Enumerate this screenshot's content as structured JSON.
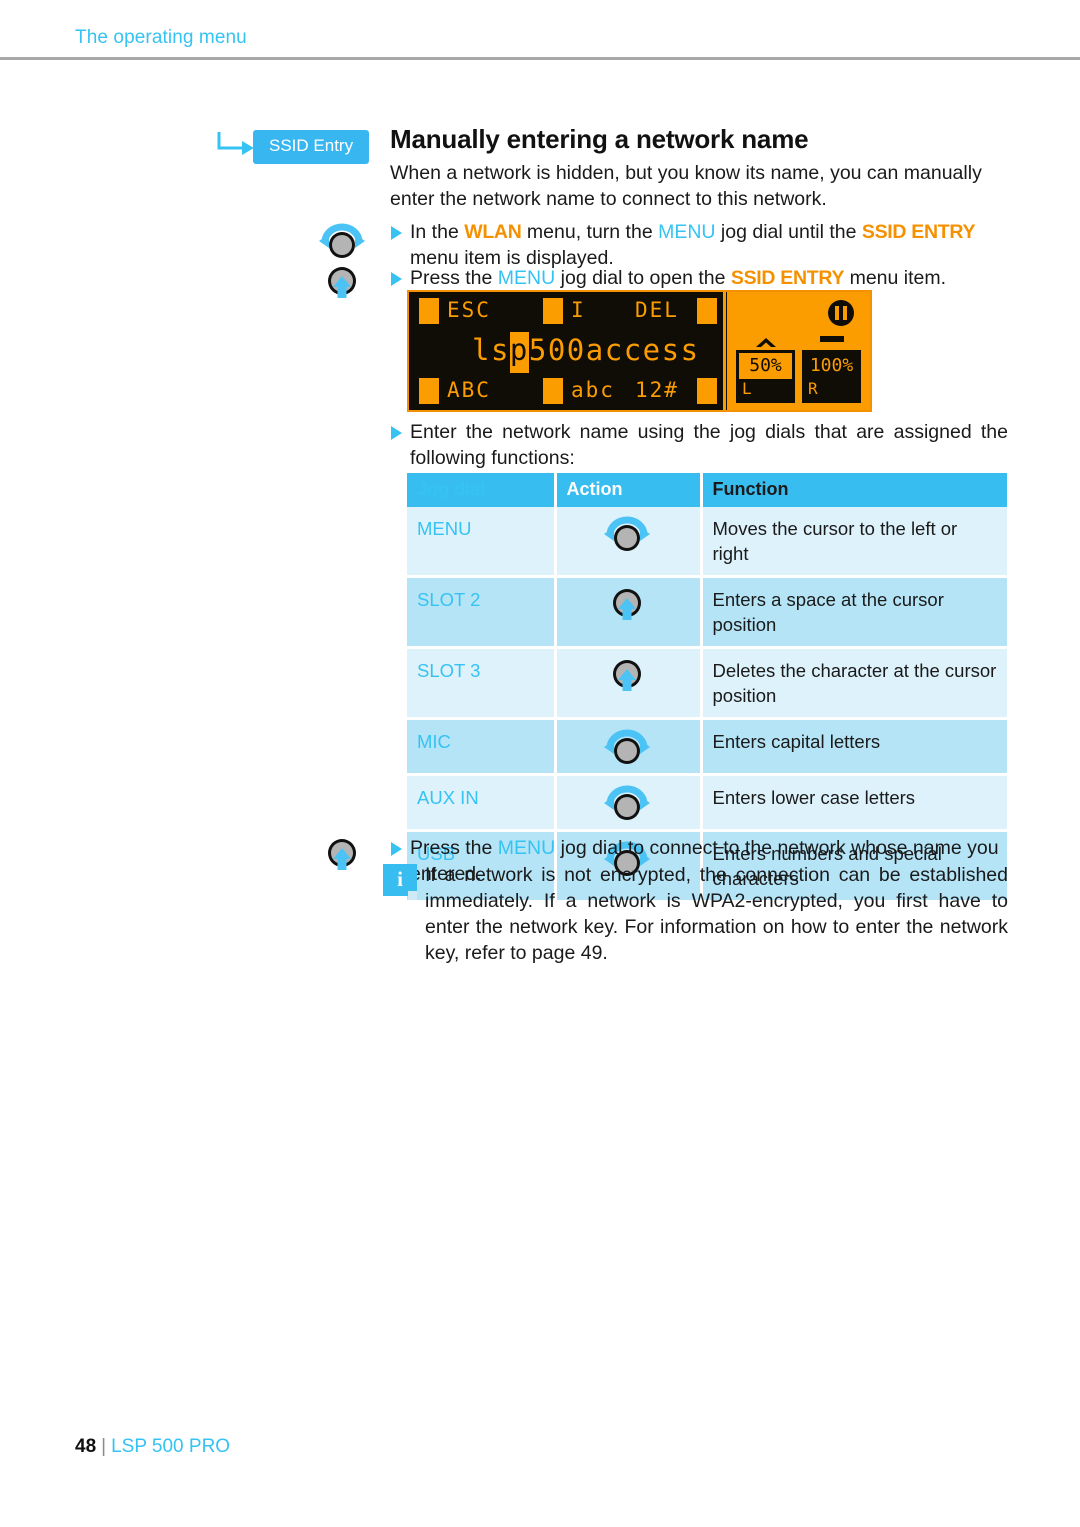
{
  "running_head": "The operating menu",
  "badge": {
    "label": "SSID Entry"
  },
  "heading": "Manually entering a network name",
  "intro": "When a network is hidden, but you know its name, you can manually enter the network name to connect to this network.",
  "steps": [
    {
      "id": "step-wlan",
      "icon": "jog-dial-rotate-icon",
      "parts": [
        {
          "t": "In the ",
          "s": "plain"
        },
        {
          "t": "WLAN",
          "s": "orange"
        },
        {
          "t": " menu, turn the ",
          "s": "plain"
        },
        {
          "t": "MENU",
          "s": "blue"
        },
        {
          "t": " jog dial until the ",
          "s": "plain"
        },
        {
          "t": "SSID ENTRY",
          "s": "orange"
        },
        {
          "t": " menu item is displayed.",
          "s": "plain"
        }
      ]
    },
    {
      "id": "step-press",
      "icon": "jog-dial-press-icon",
      "parts": [
        {
          "t": "Press the ",
          "s": "plain"
        },
        {
          "t": "MENU",
          "s": "blue"
        },
        {
          "t": " jog dial to open the ",
          "s": "plain"
        },
        {
          "t": "SSID ENTRY",
          "s": "orange"
        },
        {
          "t": " menu item.",
          "s": "plain"
        }
      ]
    }
  ],
  "lcd": {
    "top_labels": [
      "ESC",
      "I",
      "DEL"
    ],
    "bottom_labels": [
      "ABC",
      "abc",
      "12#"
    ],
    "ssid_before": "ls",
    "ssid_cursor": "p",
    "ssid_after": "500access",
    "left_meter": {
      "value": "50%",
      "channel": "L"
    },
    "right_meter": {
      "value": "100%",
      "channel": "R"
    },
    "status_icon": "pause-icon",
    "colors": {
      "amber": "#fb9c00",
      "background": "#100d07"
    }
  },
  "table_intro": "Enter the network name using the jog dials that are assigned the following functions:",
  "table": {
    "headers": [
      "Jog dial",
      "Action",
      "Function"
    ],
    "rows": [
      {
        "key": "MENU",
        "action_icon": "jog-dial-rotate-icon",
        "function": "Moves the cursor to the left or right"
      },
      {
        "key": "SLOT 2",
        "action_icon": "jog-dial-press-icon",
        "function": "Enters a space at the cursor position"
      },
      {
        "key": "SLOT 3",
        "action_icon": "jog-dial-press-icon",
        "function": "Deletes the character at the cursor position"
      },
      {
        "key": "MIC",
        "action_icon": "jog-dial-rotate-icon",
        "function": "Enters capital letters"
      },
      {
        "key": "AUX IN",
        "action_icon": "jog-dial-rotate-icon",
        "function": "Enters lower case letters"
      },
      {
        "key": "USB",
        "action_icon": "jog-dial-rotate-icon",
        "function": "Enters numbers and special characters"
      }
    ]
  },
  "final_step": {
    "icon": "jog-dial-press-icon",
    "parts": [
      {
        "t": "Press the ",
        "s": "plain"
      },
      {
        "t": "MENU",
        "s": "blue"
      },
      {
        "t": " jog dial to connect to the network whose name you entered.",
        "s": "plain"
      }
    ]
  },
  "note": {
    "icon": "info-icon",
    "text": "If a network is not encrypted, the connection can be established immediately. If a network is WPA2-encrypted, you first have to enter the network key. For information on how to enter the network key, refer to page 49."
  },
  "footer": {
    "page": "48",
    "separator": "|",
    "product": "LSP 500 PRO"
  },
  "colors": {
    "accent_blue": "#35c3f3",
    "badge_blue": "#38b6f0",
    "amber": "#f59100"
  }
}
